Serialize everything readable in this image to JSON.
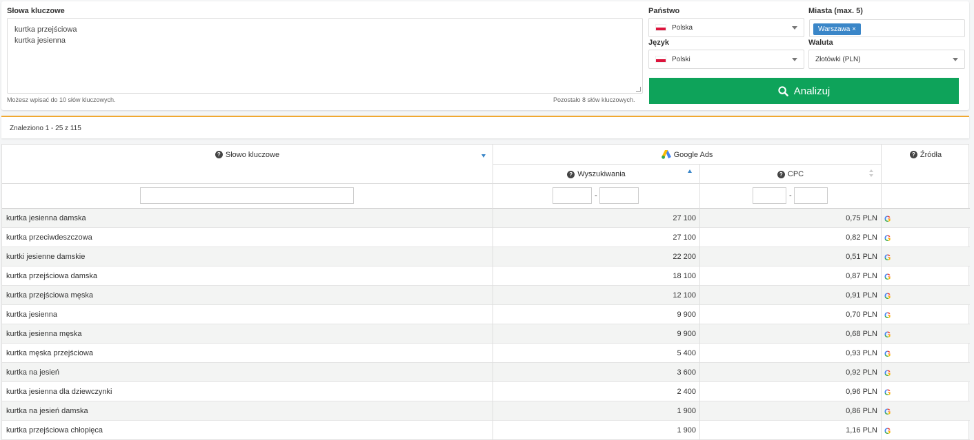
{
  "form": {
    "keywords_label": "Słowa kluczowe",
    "keywords_lines": [
      "kurtka przejściowa",
      "kurtka jesienna"
    ],
    "keywords_hint": "Możesz wpisać do 10 słów kluczowych.",
    "keywords_remaining": "Pozostało 8 słów kluczowych.",
    "country_label": "Państwo",
    "country_value": "Polska",
    "cities_label": "Miasta (max. 5)",
    "city_tag": "Warszawa ×",
    "language_label": "Język",
    "language_value": "Polski",
    "currency_label": "Waluta",
    "currency_value": "Złotówki (PLN)",
    "analyze_button": "Analizuj",
    "flag_color": "#dc143c",
    "button_color": "#0ea35a"
  },
  "results": {
    "found_text": "Znaleziono 1 - 25 z 115"
  },
  "table": {
    "headers": {
      "keyword": "Słowo kluczowe",
      "google_ads": "Google Ads",
      "searches": "Wyszukiwania",
      "cpc": "CPC",
      "sources": "Źródła",
      "range_dash_1": "-",
      "range_dash_2": "-"
    },
    "rows": [
      {
        "keyword": "kurtka jesienna damska",
        "searches": "27 100",
        "cpc": "0,75 PLN",
        "source": "G"
      },
      {
        "keyword": "kurtka przeciwdeszczowa",
        "searches": "27 100",
        "cpc": "0,82 PLN",
        "source": "G"
      },
      {
        "keyword": "kurtki jesienne damskie",
        "searches": "22 200",
        "cpc": "0,51 PLN",
        "source": "G"
      },
      {
        "keyword": "kurtka przejściowa damska",
        "searches": "18 100",
        "cpc": "0,87 PLN",
        "source": "G"
      },
      {
        "keyword": "kurtka przejściowa męska",
        "searches": "12 100",
        "cpc": "0,91 PLN",
        "source": "G"
      },
      {
        "keyword": "kurtka jesienna",
        "searches": "9 900",
        "cpc": "0,70 PLN",
        "source": "G"
      },
      {
        "keyword": "kurtka jesienna męska",
        "searches": "9 900",
        "cpc": "0,68 PLN",
        "source": "G"
      },
      {
        "keyword": "kurtka męska przejściowa",
        "searches": "5 400",
        "cpc": "0,93 PLN",
        "source": "G"
      },
      {
        "keyword": "kurtka na jesień",
        "searches": "3 600",
        "cpc": "0,92 PLN",
        "source": "G"
      },
      {
        "keyword": "kurtka jesienna dla dziewczynki",
        "searches": "2 400",
        "cpc": "0,96 PLN",
        "source": "G"
      },
      {
        "keyword": "kurtka na jesień damska",
        "searches": "1 900",
        "cpc": "0,86 PLN",
        "source": "G"
      },
      {
        "keyword": "kurtka przejściowa chłopięca",
        "searches": "1 900",
        "cpc": "1,16 PLN",
        "source": "G"
      }
    ]
  }
}
